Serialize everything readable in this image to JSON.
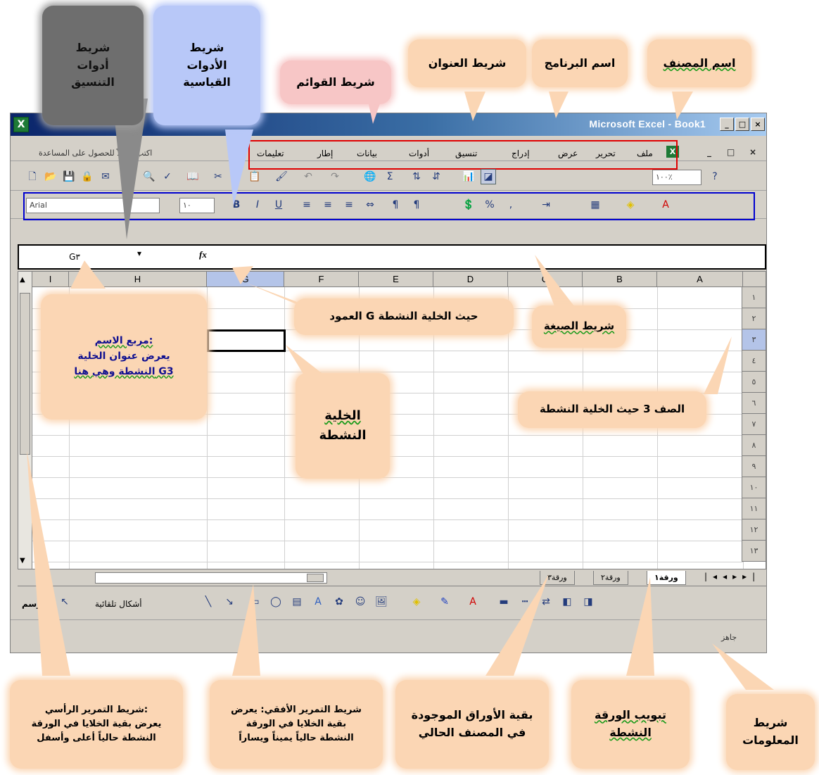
{
  "window": {
    "title": "Microsoft Excel - Book1",
    "controls": {
      "minimize": "_",
      "maximize": "□",
      "close": "×"
    }
  },
  "menubar": {
    "items": [
      "ملف",
      "تحرير",
      "عرض",
      "إدراج",
      "تنسيق",
      "أدوات",
      "بيانات",
      "إطار",
      "تعليمات"
    ],
    "help_box": "اكتب سؤالاً للحصول على المساعدة",
    "doc_controls": [
      "_",
      "□",
      "×"
    ]
  },
  "standard_toolbar": {
    "zoom": "١٠٠٪"
  },
  "formatting_toolbar": {
    "font": "Arial",
    "size": "١٠",
    "bold": "B",
    "italic": "I",
    "underline": "U"
  },
  "formula_bar": {
    "name_box": "G٣",
    "fx": "fx"
  },
  "sheet": {
    "columns": [
      "A",
      "B",
      "C",
      "D",
      "E",
      "F",
      "G",
      "H",
      "I"
    ],
    "rows": [
      "١",
      "٢",
      "٣",
      "٤",
      "٥",
      "٦",
      "٧",
      "٨",
      "٩",
      "١٠",
      "١١",
      "١٢",
      "١٣"
    ],
    "active_cell": "G3"
  },
  "sheet_tabs": [
    "ورقة١",
    "ورقة٢",
    "ورقة٣"
  ],
  "drawing_toolbar": {
    "autoshapes": "أشكال تلقائية",
    "draw": "رسم"
  },
  "status_bar": {
    "text": "جاهز"
  },
  "callouts": {
    "workbook_name": "اسم المصنف",
    "program_name": "اسم البرنامج",
    "title_bar": "شريط العنوان",
    "menu_bar": "شريط القوائم",
    "standard_toolbar": [
      "شريط",
      "الأدوات",
      "القياسية"
    ],
    "formatting_toolbar": [
      "شريط",
      "أدوات",
      "التنسيق"
    ],
    "name_box": [
      "مربع الاسم:",
      "يعرض عنوان الخلية",
      "النشطة وهي هنا G3"
    ],
    "column_g": "العمود G حيث الخلية النشطة",
    "formula_bar": "شريط الصيغة",
    "row_3": "الصف 3 حيث الخلية النشطة",
    "active_cell": [
      "الخلية",
      "النشطة"
    ],
    "v_scroll": [
      "شريط التمرير الرأسي:",
      "يعرض بقية الخلايا في الورقة",
      "النشطة حالياً أعلى وأسفل"
    ],
    "h_scroll": [
      "شريط التمرير الأفقي: يعرض",
      "بقية الخلايا في الورقة",
      "النشطة حالياً يميناً ويساراً"
    ],
    "other_sheets": [
      "بقية الأوراق الموجودة",
      "في المصنف الحالي"
    ],
    "active_sheet": [
      "تبويب الورقة",
      "النشطة"
    ],
    "status_bar": [
      "شريط",
      "المعلومات"
    ]
  },
  "colors": {
    "menu_frame": "#e00000",
    "format_frame": "#0000d0",
    "callout": "#fbd6b4",
    "callout_blue": "#b8c8f8",
    "titlebar": "#0a246a"
  }
}
